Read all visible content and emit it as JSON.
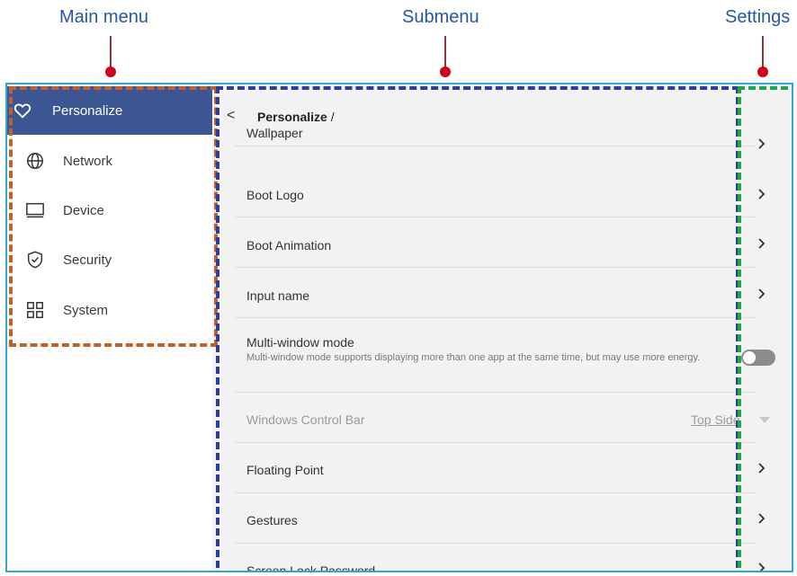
{
  "callouts": {
    "main_menu": "Main menu",
    "submenu": "Submenu",
    "settings": "Settings"
  },
  "sidebar": {
    "items": [
      {
        "label": "Personalize",
        "icon": "heart-icon",
        "active": true
      },
      {
        "label": "Network",
        "icon": "globe-icon",
        "active": false
      },
      {
        "label": "Device",
        "icon": "monitor-icon",
        "active": false
      },
      {
        "label": "Security",
        "icon": "shield-check-icon",
        "active": false
      },
      {
        "label": "System",
        "icon": "grid-icon",
        "active": false
      }
    ]
  },
  "main": {
    "back": "<",
    "breadcrumb": {
      "current": "Personalize",
      "sep": " /"
    },
    "rows": [
      {
        "title": "Wallpaper"
      },
      {
        "title": "Boot Logo"
      },
      {
        "title": "Boot Animation"
      },
      {
        "title": "Input name"
      },
      {
        "title": "Multi-window mode",
        "desc": "Multi-window mode supports displaying more than one app at the same time, but may use more energy.",
        "toggle": "off"
      },
      {
        "title": "Windows Control Bar",
        "value": "Top Side",
        "disabled": true
      },
      {
        "title": "Floating Point"
      },
      {
        "title": "Gestures"
      },
      {
        "title": "Screen Lock Password"
      }
    ]
  },
  "colors": {
    "accent": "#3c5694",
    "frame": "#29a9e0",
    "main_menu_outline": "#c0602a",
    "submenu_outline": "#2d3f9a",
    "settings_outline": "#1fa84a",
    "callout": "#2457a5"
  }
}
